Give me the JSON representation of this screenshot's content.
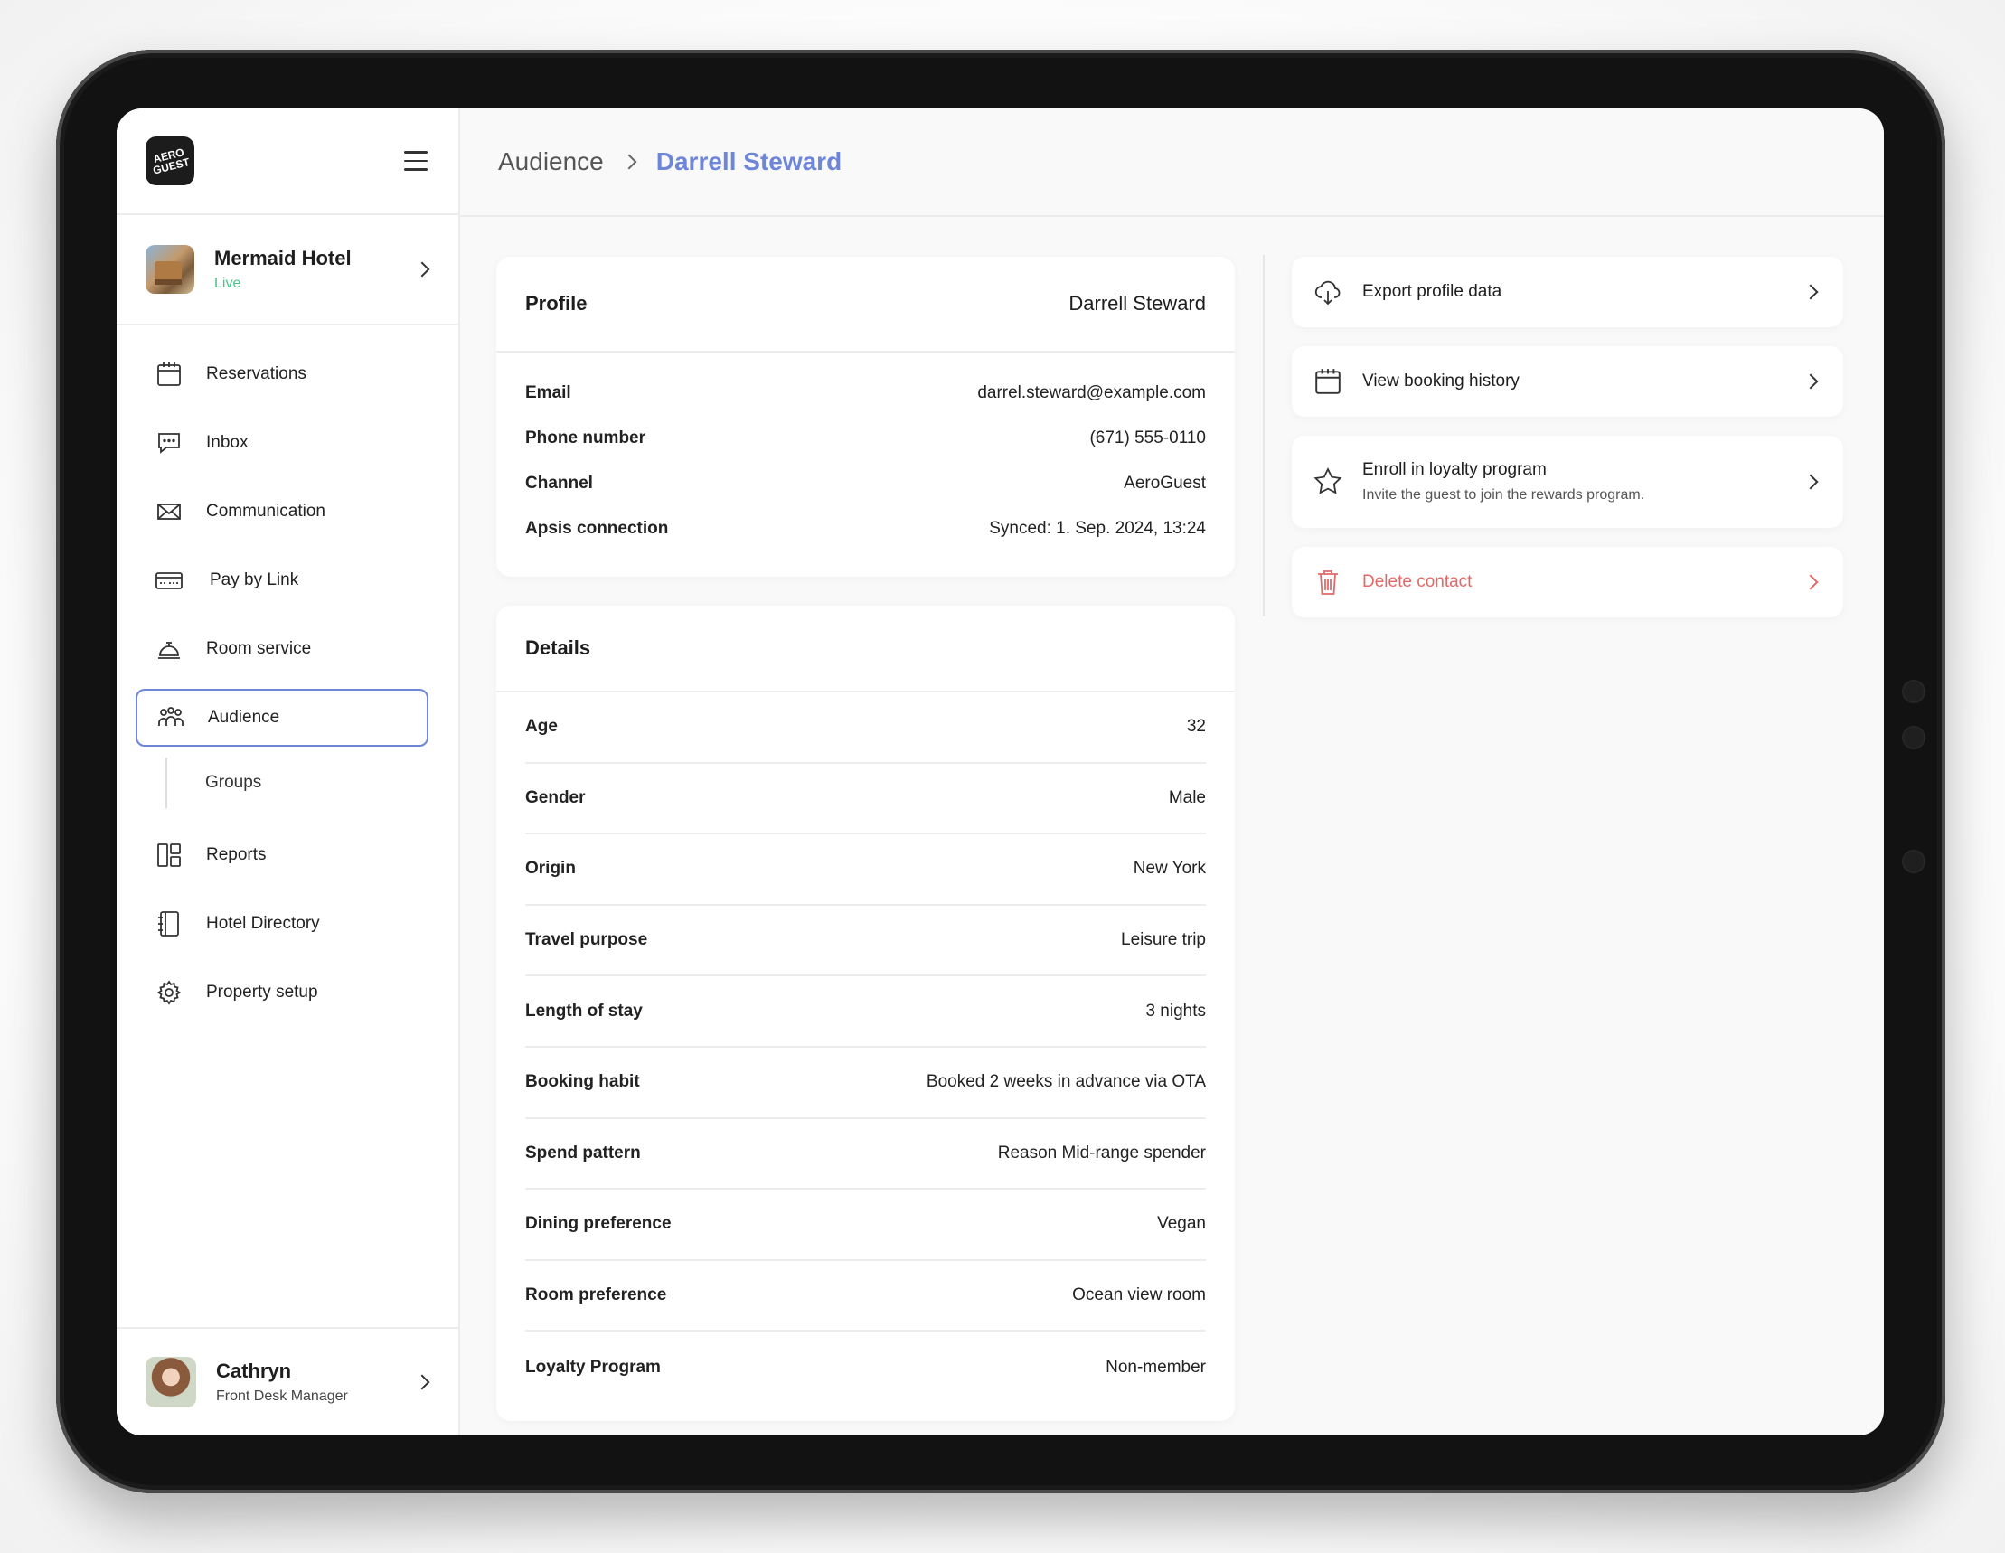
{
  "sidebar": {
    "logo_text": "AERO GUEST",
    "hotel": {
      "name": "Mermaid Hotel",
      "status": "Live"
    },
    "nav": [
      {
        "label": "Reservations",
        "icon": "calendar-icon"
      },
      {
        "label": "Inbox",
        "icon": "chat-bubble-icon"
      },
      {
        "label": "Communication",
        "icon": "envelope-icon"
      },
      {
        "label": "Pay by Link",
        "icon": "card-link-icon"
      },
      {
        "label": "Room service",
        "icon": "service-bell-icon"
      },
      {
        "label": "Audience",
        "icon": "people-icon",
        "active": true
      },
      {
        "label": "Groups",
        "sub": true
      },
      {
        "label": "Reports",
        "icon": "layout-icon"
      },
      {
        "label": "Hotel Directory",
        "icon": "notebook-icon"
      },
      {
        "label": "Property setup",
        "icon": "gear-icon"
      }
    ],
    "user": {
      "name": "Cathryn",
      "role": "Front Desk Manager"
    }
  },
  "breadcrumb": {
    "root": "Audience",
    "current": "Darrell Steward"
  },
  "profile": {
    "title": "Profile",
    "name": "Darrell Steward",
    "fields": [
      {
        "label": "Email",
        "value": "darrel.steward@example.com"
      },
      {
        "label": "Phone number",
        "value": "(671) 555-0110"
      },
      {
        "label": "Channel",
        "value": "AeroGuest"
      },
      {
        "label": "Apsis connection",
        "value": "Synced: 1. Sep. 2024, 13:24"
      }
    ]
  },
  "details": {
    "title": "Details",
    "fields": [
      {
        "label": "Age",
        "value": "32"
      },
      {
        "label": "Gender",
        "value": "Male"
      },
      {
        "label": "Origin",
        "value": "New York"
      },
      {
        "label": "Travel purpose",
        "value": "Leisure trip"
      },
      {
        "label": "Length of stay",
        "value": "3 nights"
      },
      {
        "label": "Booking habit",
        "value": "Booked 2 weeks in advance via OTA"
      },
      {
        "label": "Spend pattern",
        "value": "Reason Mid-range spender"
      },
      {
        "label": "Dining preference",
        "value": "Vegan"
      },
      {
        "label": "Room preference",
        "value": "Ocean view room"
      },
      {
        "label": "Loyalty Program",
        "value": "Non-member"
      }
    ]
  },
  "actions": [
    {
      "label": "Export profile data",
      "icon": "cloud-download-icon"
    },
    {
      "label": "View booking history",
      "icon": "calendar-icon"
    },
    {
      "label": "Enroll in loyalty program",
      "sub": "Invite the guest to join the rewards program.",
      "icon": "star-icon"
    },
    {
      "label": "Delete contact",
      "icon": "trash-icon",
      "danger": true
    }
  ],
  "colors": {
    "accent": "#6e86d8",
    "live": "#4cc38a",
    "danger": "#e06a6a"
  }
}
